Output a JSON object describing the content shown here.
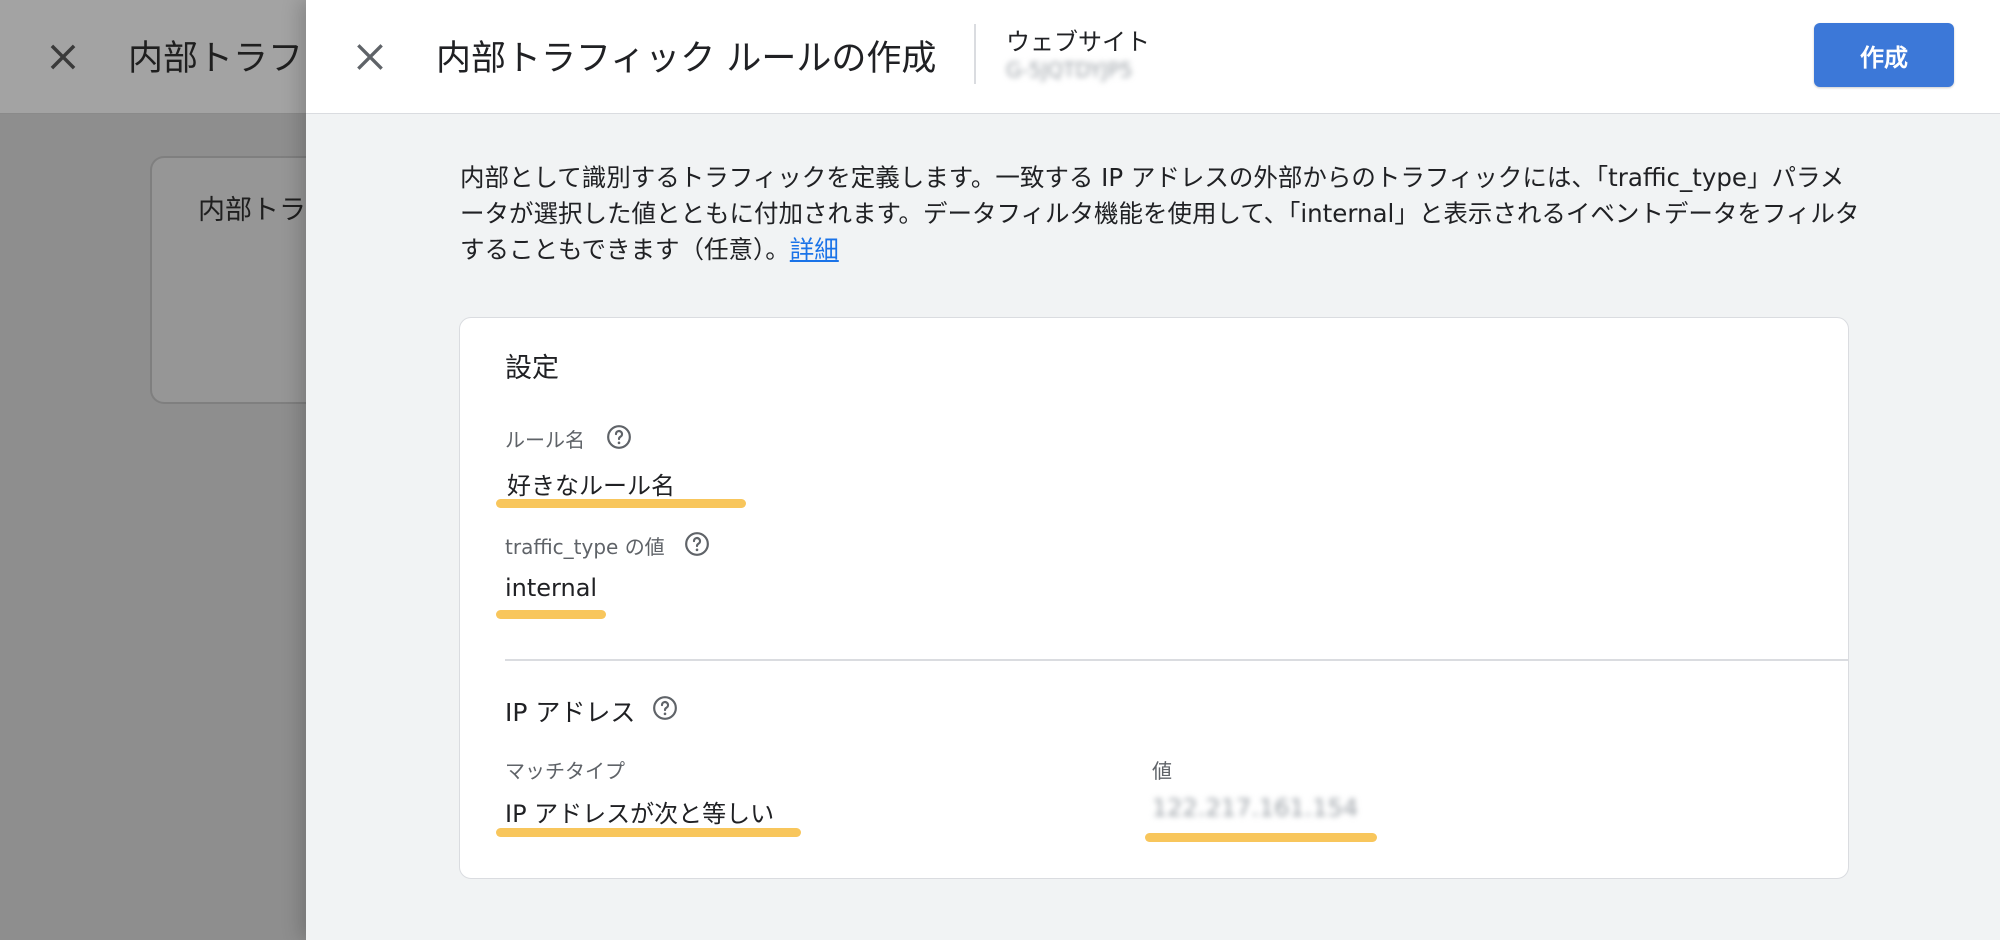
{
  "background": {
    "title": "内部トラフ",
    "card_title": "内部トラ"
  },
  "drawer": {
    "title": "内部トラフィック ルールの作成",
    "stream_label": "ウェブサイト",
    "stream_id": "G-5JQTDYJP5",
    "create_label": "作成",
    "description": "内部として識別するトラフィックを定義します。一致する IP アドレスの外部からのトラフィックには、「traffic_type」パラメータが選択した値とともに付加されます。データフィルタ機能を使用して、「internal」と表示されるイベントデータをフィルタすることもできます（任意）。",
    "learn_more": "詳細"
  },
  "settings": {
    "title": "設定",
    "rule_name_label": "ルール名",
    "rule_name_value": "好きなルール名",
    "traffic_type_label": "traffic_type の値",
    "traffic_type_value": "internal"
  },
  "ip_section": {
    "title": "IP アドレス",
    "match_type_label": "マッチタイプ",
    "match_type_value": "IP アドレスが次と等しい",
    "value_label": "値",
    "value": "122.217.161.154"
  },
  "colors": {
    "primary": "#3c78d8",
    "link": "#1a73e8",
    "highlight": "#f7c04a",
    "drawer_bg": "#f1f3f4"
  }
}
